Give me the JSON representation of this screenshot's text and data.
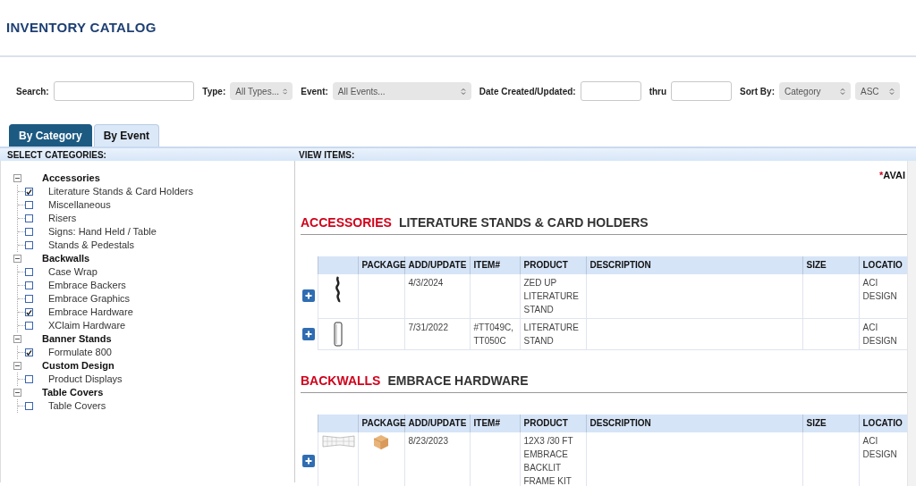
{
  "title": "INVENTORY CATALOG",
  "filters": [
    {
      "kind": "text",
      "label": "Search:"
    },
    {
      "kind": "select",
      "label": "Type:",
      "value": "All Types..."
    },
    {
      "kind": "select",
      "label": "Event:",
      "value": "All Events..."
    },
    {
      "kind": "date",
      "label": "Date Created/Updated:"
    },
    {
      "kind": "date",
      "label": "thru"
    },
    {
      "kind": "select",
      "label": "Sort By:",
      "value": "Category"
    },
    {
      "kind": "select",
      "value": "ASC"
    }
  ],
  "tabs": [
    {
      "label": "By Category",
      "selected": true
    },
    {
      "label": "By Event",
      "selected": false
    }
  ],
  "left_header": "SELECT CATEGORIES:",
  "right_header": "VIEW ITEMS:",
  "categories": [
    {
      "label": "Accessories",
      "expanded": true,
      "children": [
        {
          "label": "Literature Stands & Card Holders",
          "checked": true
        },
        {
          "label": "Miscellaneous",
          "checked": false
        },
        {
          "label": "Risers",
          "checked": false
        },
        {
          "label": "Signs: Hand Held / Table",
          "checked": false
        },
        {
          "label": "Stands & Pedestals",
          "checked": false
        }
      ]
    },
    {
      "label": "Backwalls",
      "expanded": true,
      "children": [
        {
          "label": "Case Wrap",
          "checked": false
        },
        {
          "label": "Embrace Backers",
          "checked": false
        },
        {
          "label": "Embrace Graphics",
          "checked": false
        },
        {
          "label": "Embrace Hardware",
          "checked": true
        },
        {
          "label": "XClaim Hardware",
          "checked": false
        }
      ]
    },
    {
      "label": "Banner Stands",
      "expanded": true,
      "children": [
        {
          "label": "Formulate 800",
          "checked": true
        }
      ]
    },
    {
      "label": "Custom Design",
      "expanded": true,
      "children": [
        {
          "label": "Product Displays",
          "checked": false
        }
      ]
    },
    {
      "label": "Table Covers",
      "expanded": true,
      "children": [
        {
          "label": "Table Covers",
          "checked": false
        }
      ]
    }
  ],
  "availability_note": {
    "mark": "*",
    "text": "AVAI"
  },
  "sections": [
    {
      "category": "ACCESSORIES",
      "subcategory": "LITERATURE STANDS & CARD HOLDERS",
      "columns": [
        "",
        "PACKAGE",
        "ADD/UPDATE",
        "ITEM#",
        "PRODUCT",
        "DESCRIPTION",
        "SIZE",
        "LOCATIO"
      ],
      "rows": [
        {
          "kind": "spiral",
          "package": false,
          "cells": [
            "",
            "",
            "4/3/2024",
            "",
            "ZED UP LITERATURE STAND",
            "",
            "",
            "ACI DESIGN"
          ]
        },
        {
          "kind": "tube",
          "package": false,
          "cells": [
            "",
            "",
            "7/31/2022",
            "#TT049C, TT050C",
            "LITERATURE STAND",
            "",
            "",
            "ACI DESIGN"
          ]
        }
      ]
    },
    {
      "category": "BACKWALLS",
      "subcategory": "EMBRACE HARDWARE",
      "columns": [
        "",
        "PACKAGE",
        "ADD/UPDATE",
        "ITEM#",
        "PRODUCT",
        "DESCRIPTION",
        "SIZE",
        "LOCATIO"
      ],
      "rows": [
        {
          "kind": "frame",
          "package": true,
          "cells": [
            "",
            "",
            "8/23/2023",
            "",
            "12X3 /30 FT EMBRACE BACKLIT FRAME KIT",
            "",
            "",
            "ACI DESIGN"
          ]
        }
      ]
    }
  ]
}
